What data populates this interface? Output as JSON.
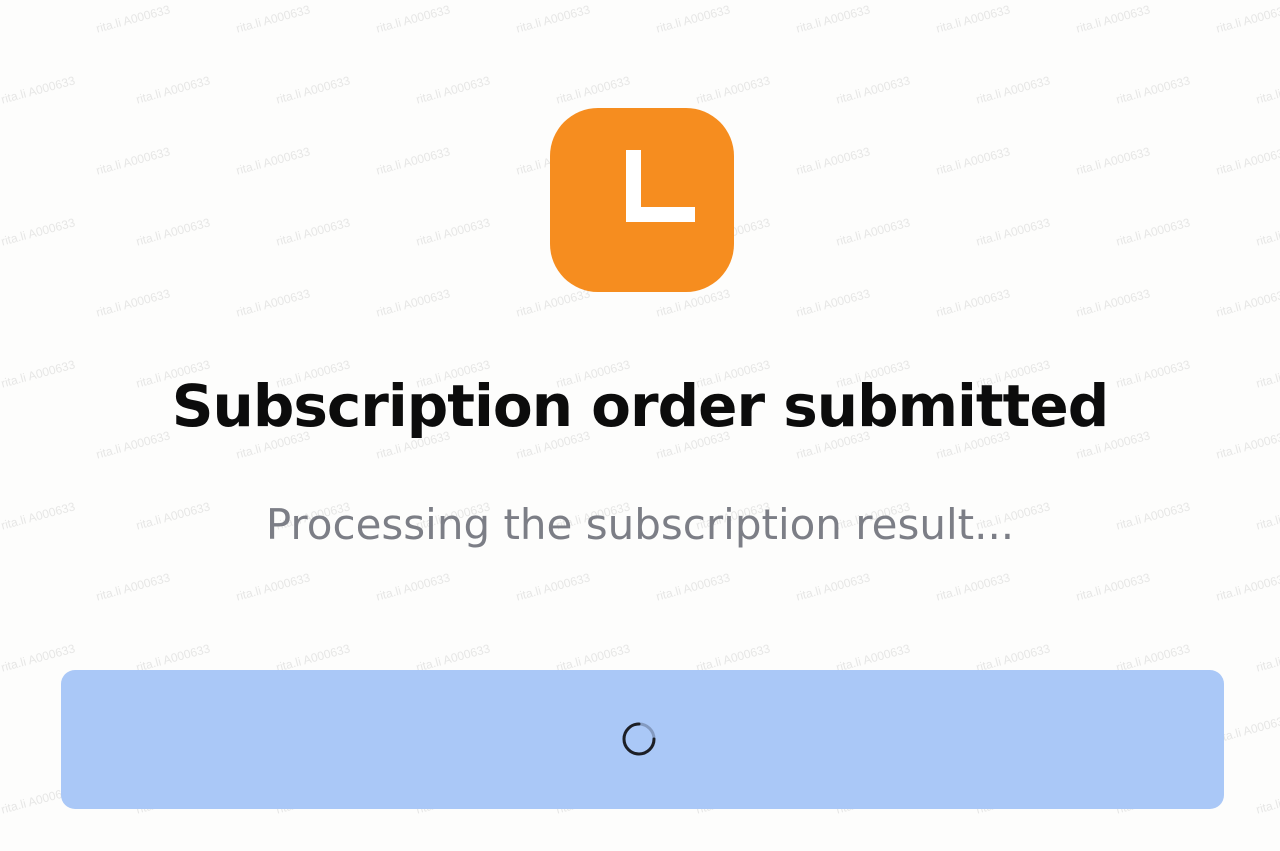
{
  "status": {
    "icon": "clock-icon",
    "color": "#f68d1f"
  },
  "title": "Subscription order submitted",
  "subtitle": "Processing the subscription result...",
  "button": {
    "state": "loading",
    "color": "#aac8f7",
    "spinner_icon": "loading-spinner-icon"
  },
  "watermark": {
    "text": "rita.li A000633"
  }
}
